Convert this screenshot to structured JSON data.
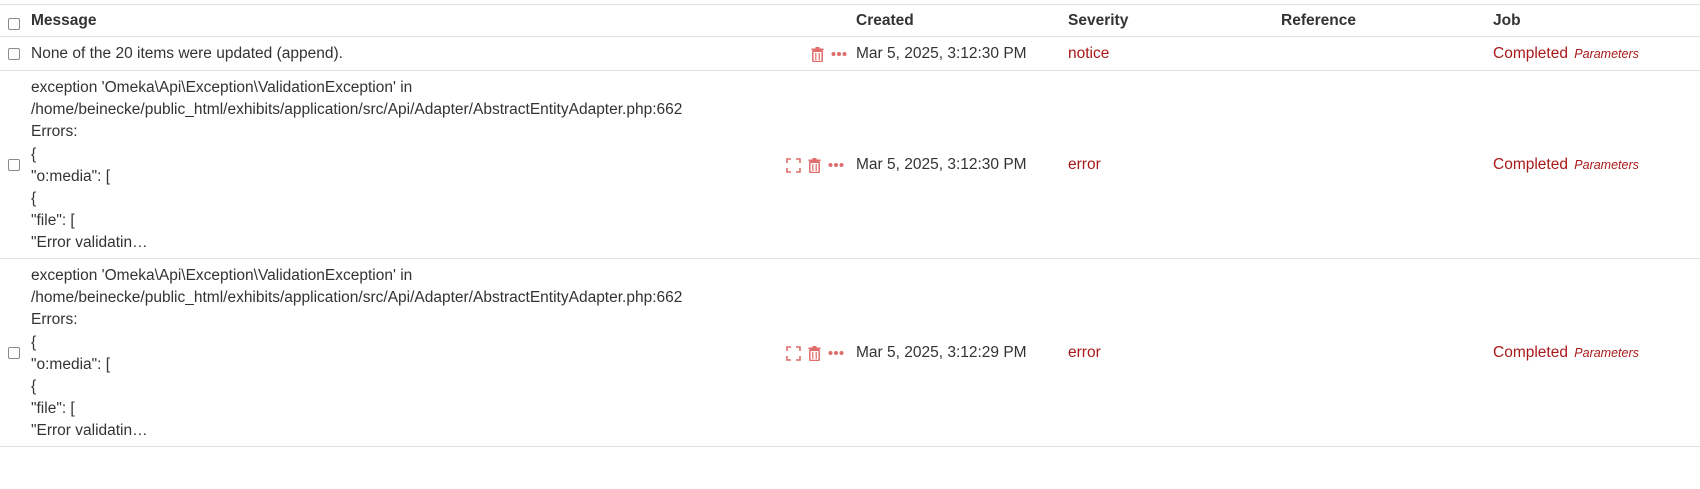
{
  "columns": {
    "message": "Message",
    "created": "Created",
    "severity": "Severity",
    "reference": "Reference",
    "job": "Job"
  },
  "rows": [
    {
      "message_lines": [
        "None of the 20 items were updated (append)."
      ],
      "created": "Mar 5, 2025, 3:12:30 PM",
      "severity": "notice",
      "reference": "",
      "job_status": "Completed",
      "job_params": "Parameters",
      "has_expand": false
    },
    {
      "message_lines": [
        "exception 'Omeka\\Api\\Exception\\ValidationException' in",
        "/home/beinecke/public_html/exhibits/application/src/Api/Adapter/AbstractEntityAdapter.php:662",
        "Errors:",
        "{",
        "\"o:media\": [",
        "{",
        "\"file\": [",
        "\"Error validatin…"
      ],
      "created": "Mar 5, 2025, 3:12:30 PM",
      "severity": "error",
      "reference": "",
      "job_status": "Completed",
      "job_params": "Parameters",
      "has_expand": true
    },
    {
      "message_lines": [
        "exception 'Omeka\\Api\\Exception\\ValidationException' in",
        "/home/beinecke/public_html/exhibits/application/src/Api/Adapter/AbstractEntityAdapter.php:662",
        "Errors:",
        "{",
        "\"o:media\": [",
        "{",
        "\"file\": [",
        "\"Error validatin…"
      ],
      "created": "Mar 5, 2025, 3:12:29 PM",
      "severity": "error",
      "reference": "",
      "job_status": "Completed",
      "job_params": "Parameters",
      "has_expand": true
    }
  ],
  "icons": {
    "expand": "expand-icon",
    "delete": "trash-icon",
    "more": "more-actions-icon"
  },
  "colors": {
    "accent": "#a91919",
    "icon": "#e06c6c",
    "text": "#333333",
    "border": "#dfdfdf"
  }
}
